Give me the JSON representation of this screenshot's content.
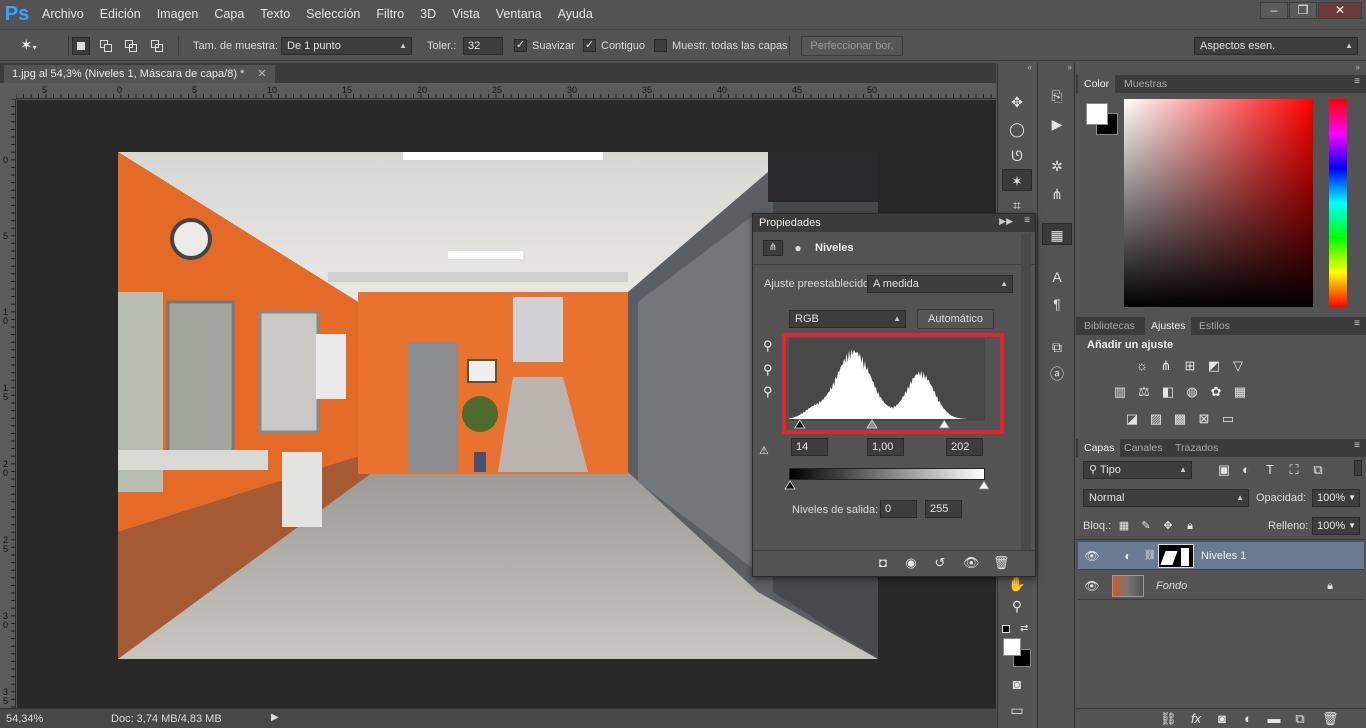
{
  "app": {
    "logo": "Ps"
  },
  "menu": [
    "Archivo",
    "Edición",
    "Imagen",
    "Capa",
    "Texto",
    "Selección",
    "Filtro",
    "3D",
    "Vista",
    "Ventana",
    "Ayuda"
  ],
  "window_controls": {
    "minimize": "‒",
    "restore": "❐",
    "close": "✕"
  },
  "options": {
    "sample_label": "Tam. de muestra:",
    "sample_value": "De 1 punto",
    "tolerance_label": "Toler.:",
    "tolerance_value": "32",
    "smooth_label": "Suavizar",
    "contiguous_label": "Contiguo",
    "all_layers_label": "Muestr. todas las capas",
    "refine_label": "Perfeccionar bor.",
    "workspace": "Aspectos esen."
  },
  "document": {
    "tab_title": "1.jpg al 54,3% (Niveles 1, Máscara de capa/8) *",
    "tab_close": "✕",
    "zoom": "54,34%",
    "doc_info": "Doc: 3,74 MB/4,83 MB"
  },
  "ruler_top_labels": [
    "5",
    "0",
    "5",
    "10",
    "15",
    "20",
    "25",
    "30",
    "35",
    "40",
    "45",
    "50"
  ],
  "ruler_left_labels": [
    "0",
    "5",
    "1 0",
    "1 5",
    "2 0",
    "2 5",
    "3 0",
    "3 5"
  ],
  "properties": {
    "title": "Propiedades",
    "panel_name": "Niveles",
    "preset_label": "Ajuste preestablecido:",
    "preset_value": "A medida",
    "channel": "RGB",
    "auto_label": "Automático",
    "input_black": "14",
    "input_gray": "1,00",
    "input_white": "202",
    "output_label": "Niveles de salida:",
    "output_black": "0",
    "output_white": "255",
    "input_black_level": 14,
    "input_white_level": 202,
    "highlight_color": "#e0262b"
  },
  "color_panel": {
    "tabs": [
      "Color",
      "Muestras"
    ],
    "active": "Color"
  },
  "adjust_panel": {
    "tabs": [
      "Bibliotecas",
      "Ajustes",
      "Estilos"
    ],
    "active": "Ajustes",
    "title": "Añadir un ajuste"
  },
  "layers_panel": {
    "tabs": [
      "Capas",
      "Canales",
      "Trazados"
    ],
    "active": "Capas",
    "filter": "Tipo",
    "blend_mode": "Normal",
    "opacity_label": "Opacidad:",
    "opacity_value": "100%",
    "lock_label": "Bloq.:",
    "fill_label": "Relleno:",
    "fill_value": "100%",
    "layers": [
      {
        "name": "Niveles 1",
        "selected": true
      },
      {
        "name": "Fondo",
        "selected": false
      }
    ]
  }
}
